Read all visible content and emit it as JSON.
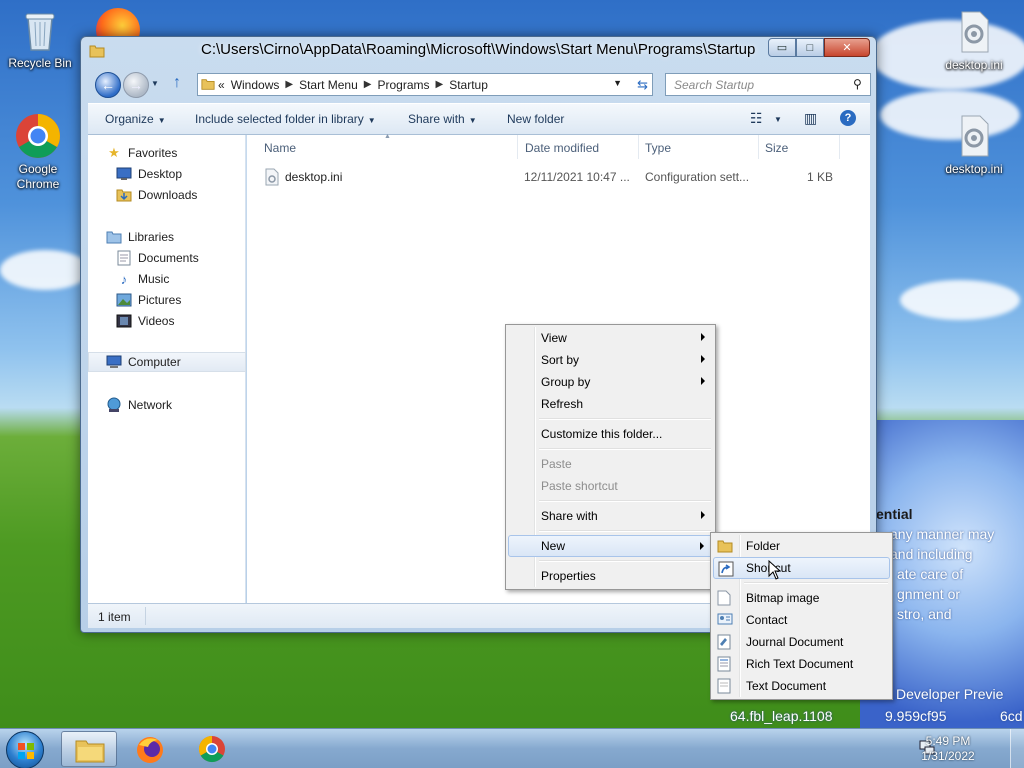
{
  "desktop": {
    "icons": [
      {
        "label": "Recycle Bin"
      },
      {
        "label": "Google Chrome"
      },
      {
        "label": "desktop.ini"
      },
      {
        "label": "desktop.ini"
      }
    ],
    "wallpaper_text": {
      "confidential_heading": "ential",
      "lines": [
        "any manner may",
        "and including",
        "ate care of",
        "gnment or",
        "stro, and"
      ],
      "build_label": "Developer Previe",
      "build_string": "64.fbl_leap.1108",
      "build_string_tail": "9.959cf95",
      "build_string_end": "6cd"
    }
  },
  "explorer": {
    "title_path": "C:\\Users\\Cirno\\AppData\\Roaming\\Microsoft\\Windows\\Start Menu\\Programs\\Startup",
    "window_buttons": {
      "minimize": "▭",
      "maximize": "□",
      "close": "✕"
    },
    "breadcrumbs": [
      "Windows",
      "Start Menu",
      "Programs",
      "Startup"
    ],
    "breadcrumb_prefix": "«",
    "search_placeholder": "Search Startup",
    "toolbar": {
      "organize": "Organize",
      "include_library": "Include selected folder in library",
      "share_with": "Share with",
      "new_folder": "New folder"
    },
    "nav_pane": {
      "favorites": "Favorites",
      "desktop": "Desktop",
      "downloads": "Downloads",
      "libraries": "Libraries",
      "documents": "Documents",
      "music": "Music",
      "pictures": "Pictures",
      "videos": "Videos",
      "computer": "Computer",
      "network": "Network"
    },
    "columns": {
      "name": "Name",
      "date_modified": "Date modified",
      "type": "Type",
      "size": "Size"
    },
    "files": [
      {
        "name": "desktop.ini",
        "date_modified": "12/11/2021 10:47 ...",
        "type": "Configuration sett...",
        "size": "1 KB"
      }
    ],
    "status": "1 item"
  },
  "context_menu": {
    "view": "View",
    "sort_by": "Sort by",
    "group_by": "Group by",
    "refresh": "Refresh",
    "customize": "Customize this folder...",
    "paste": "Paste",
    "paste_shortcut": "Paste shortcut",
    "share_with": "Share with",
    "new": "New",
    "properties": "Properties"
  },
  "new_submenu": {
    "folder": "Folder",
    "shortcut": "Shortcut",
    "bitmap": "Bitmap image",
    "contact": "Contact",
    "journal": "Journal Document",
    "rtf": "Rich Text Document",
    "text": "Text Document"
  },
  "taskbar": {
    "time": "5:49 PM",
    "date": "1/31/2022"
  },
  "colors": {
    "accent": "#1e395b",
    "highlight": "#dae6f6"
  }
}
